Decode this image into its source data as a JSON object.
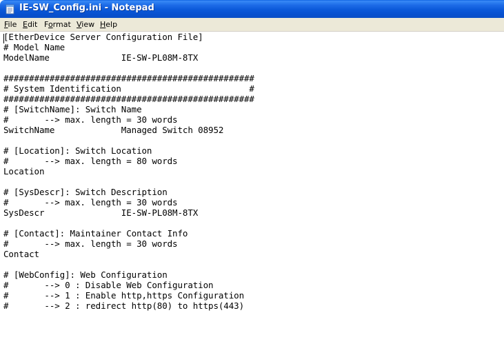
{
  "window": {
    "title": "IE-SW_Config.ini - Notepad"
  },
  "menu": {
    "items": [
      {
        "first": "F",
        "rest": "ile"
      },
      {
        "first": "E",
        "rest": "dit"
      },
      {
        "first": "",
        "mid_pre": "F",
        "mid": "o",
        "rest": "rmat"
      },
      {
        "first": "V",
        "rest": "iew"
      },
      {
        "first": "H",
        "rest": "elp"
      }
    ]
  },
  "editor": {
    "lines": [
      "[EtherDevice Server Configuration File]",
      "# Model Name",
      "ModelName              IE-SW-PL08M-8TX",
      "",
      "#################################################",
      "# System Identification                         #",
      "#################################################",
      "# [SwitchName]: Switch Name",
      "#       --> max. length = 30 words",
      "SwitchName             Managed Switch 08952",
      "",
      "# [Location]: Switch Location",
      "#       --> max. length = 80 words",
      "Location",
      "",
      "# [SysDescr]: Switch Description",
      "#       --> max. length = 30 words",
      "SysDescr               IE-SW-PL08M-8TX",
      "",
      "# [Contact]: Maintainer Contact Info",
      "#       --> max. length = 30 words",
      "Contact",
      "",
      "# [WebConfig]: Web Configuration",
      "#       --> 0 : Disable Web Configuration",
      "#       --> 1 : Enable http,https Configuration",
      "#       --> 2 : redirect http(80) to https(443)"
    ]
  }
}
